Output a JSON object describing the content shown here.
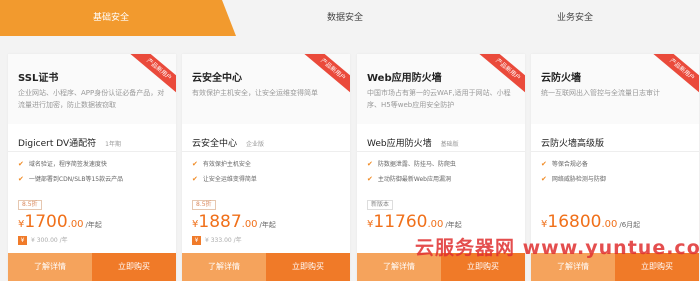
{
  "tabs": [
    {
      "label": "基础安全",
      "active": true
    },
    {
      "label": "数据安全",
      "active": false
    },
    {
      "label": "业务安全",
      "active": false
    }
  ],
  "colors": {
    "accent": "#f07a28",
    "tab_active": "#f29a2e",
    "ribbon": "#ea4a3b",
    "price": "#f0701a",
    "watermark": "#e03030"
  },
  "cards": [
    {
      "title": "SSL证书",
      "description": "企业网站、小程序、APP身份认证必备产品，对流量进行加密，防止数据被窃取",
      "ribbon": "产品新用户",
      "product": "Digicert DV通配符",
      "product_tag": "1年期",
      "features": [
        "域名验证，程序简签发速度快",
        "一键部署到CDN/SLB等15款云产品"
      ],
      "discount": "8.5折",
      "currency": "¥",
      "price_int": "1700",
      "price_dec": ".00",
      "unit": "/年起",
      "original_price": "¥ 300.00 /年",
      "original_icon": "¥",
      "detail_button": "了解详情",
      "buy_button": "立即购买"
    },
    {
      "title": "云安全中心",
      "description": "有效保护主机安全，让安全运维变得简单",
      "ribbon": "产品新用户",
      "product": "云安全中心",
      "product_tag": "企业版",
      "features": [
        "有效保护主机安全",
        "让安全运维变得简单"
      ],
      "discount": "8.5折",
      "currency": "¥",
      "price_int": "1887",
      "price_dec": ".00",
      "unit": "/年起",
      "original_price": "¥ 333.00 /年",
      "original_icon": "¥",
      "detail_button": "了解详情",
      "buy_button": "立即购买"
    },
    {
      "title": "Web应用防火墙",
      "description": "中国市场占有第一的云WAF,适用于网站、小程序、H5等web应用安全防护",
      "ribbon": "产品新用户",
      "product": "Web应用防火墙",
      "product_tag": "基础版",
      "features": [
        "防数据泄露、防挂马、防爬虫",
        "主动防御最新Web应用漏洞"
      ],
      "discount": "新版本",
      "currency": "¥",
      "price_int": "11760",
      "price_dec": ".00",
      "unit": "/年起",
      "original_price": "",
      "original_icon": "",
      "detail_button": "了解详情",
      "buy_button": "立即购买"
    },
    {
      "title": "云防火墙",
      "description": "统一互联网出入管控与全流量日志审计",
      "ribbon": "产品新用户",
      "product": "云防火墙高级版",
      "product_tag": "",
      "features": [
        "等保合规必备",
        "网络威胁检测与防御"
      ],
      "discount": "",
      "currency": "¥",
      "price_int": "16800",
      "price_dec": ".00",
      "unit": "/6月起",
      "original_price": "",
      "original_icon": "",
      "detail_button": "了解详情",
      "buy_button": "立即购买"
    }
  ],
  "watermark": "云服务器网 www.yuntue.com"
}
